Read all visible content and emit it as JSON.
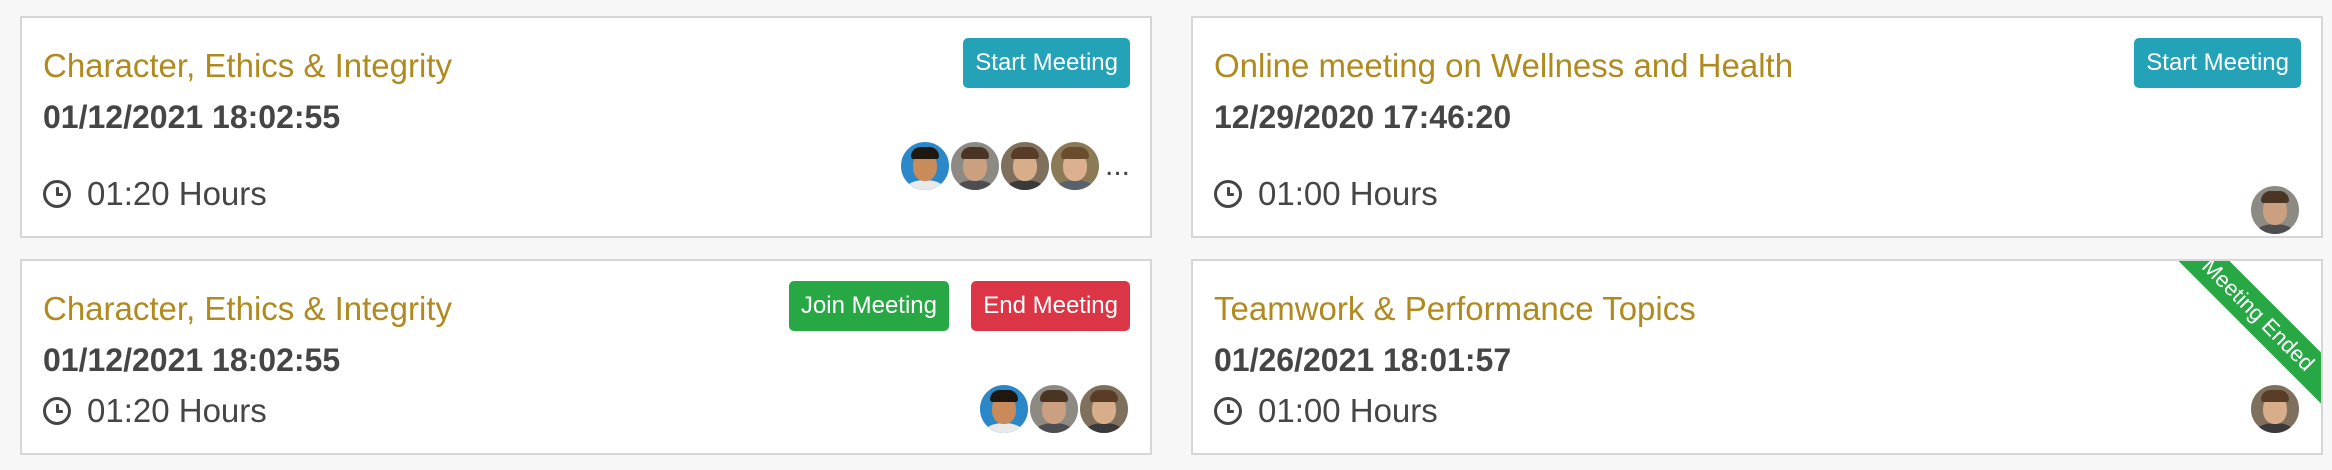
{
  "meetings": [
    {
      "title": "Character, Ethics & Integrity",
      "datetime": "01/12/2021 18:02:55",
      "duration": "01:20 Hours",
      "start_label": "Start Meeting",
      "more_label": "..."
    },
    {
      "title": "Online meeting on Wellness and Health",
      "datetime": "12/29/2020 17:46:20",
      "duration": "01:00 Hours",
      "start_label": "Start Meeting"
    },
    {
      "title": "Character, Ethics & Integrity",
      "datetime": "01/12/2021 18:02:55",
      "duration": "01:20 Hours",
      "join_label": "Join Meeting",
      "end_label": "End Meeting"
    },
    {
      "title": "Teamwork & Performance Topics",
      "datetime": "01/26/2021 18:01:57",
      "duration": "01:00 Hours",
      "status_label": "Meeting Ended"
    }
  ],
  "icons": {
    "clock": "clock-icon"
  },
  "colors": {
    "title": "#b08a1e",
    "start_button": "#23a2b8",
    "join_button": "#28a745",
    "end_button": "#dc3545",
    "ended_ribbon": "#28a745"
  }
}
